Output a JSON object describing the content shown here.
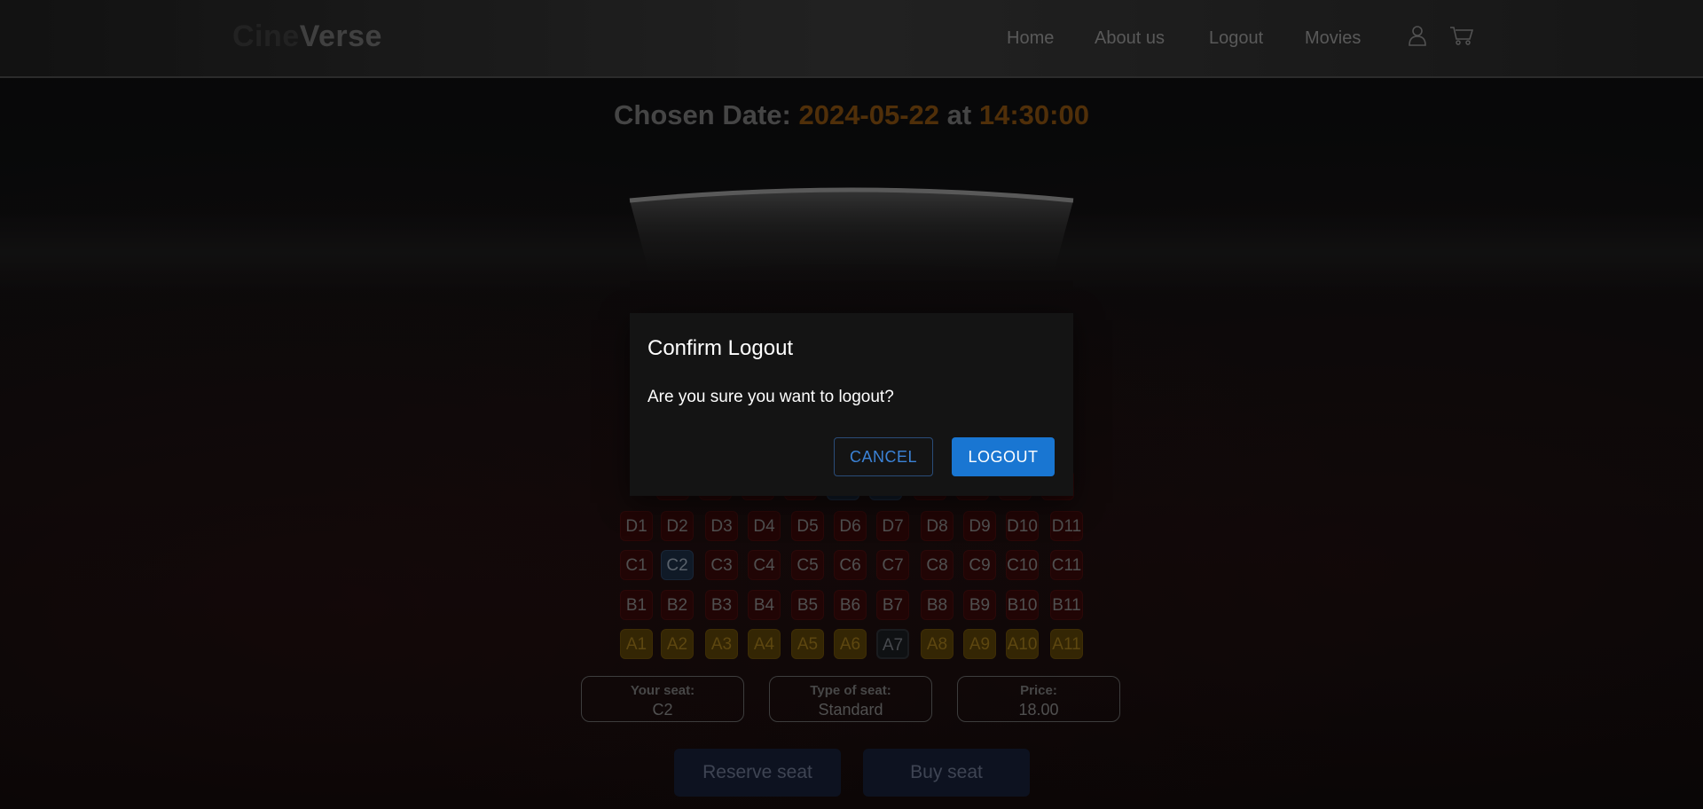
{
  "brand": {
    "part1": "Cine",
    "part2": "Verse"
  },
  "nav": {
    "home": "Home",
    "about": "About us",
    "logout": "Logout",
    "movies": "Movies",
    "user_icon": "user-icon",
    "cart_icon": "cart-icon"
  },
  "chosen": {
    "label": "Chosen Date:",
    "date": "2024-05-22",
    "at": "at",
    "time": "14:30:00"
  },
  "seats": {
    "D": [
      "D1",
      "D2",
      "D3",
      "D4",
      "D5",
      "D6",
      "D7",
      "D8",
      "D9",
      "D10",
      "D11"
    ],
    "C": [
      "C1",
      "C2",
      "C3",
      "C4",
      "C5",
      "C6",
      "C7",
      "C8",
      "C9",
      "C10",
      "C11"
    ],
    "B": [
      "B1",
      "B2",
      "B3",
      "B4",
      "B5",
      "B6",
      "B7",
      "B8",
      "B9",
      "B10",
      "B11"
    ],
    "A": [
      "A1",
      "A2",
      "A3",
      "A4",
      "A5",
      "A6",
      "A7",
      "A8",
      "A9",
      "A10",
      "A11"
    ],
    "selected": "C2",
    "unavailable": [
      "A7"
    ]
  },
  "info": {
    "seat_label": "Your seat:",
    "seat_value": "C2",
    "type_label": "Type of seat:",
    "type_value": "Standard",
    "price_label": "Price:",
    "price_value": "18.00"
  },
  "actions": {
    "reserve": "Reserve seat",
    "buy": "Buy seat"
  },
  "dialog": {
    "title": "Confirm Logout",
    "message": "Are you sure you want to logout?",
    "cancel": "CANCEL",
    "confirm": "LOGOUT"
  },
  "colors": {
    "accent": "#8a5210",
    "primary": "#1976d2"
  }
}
